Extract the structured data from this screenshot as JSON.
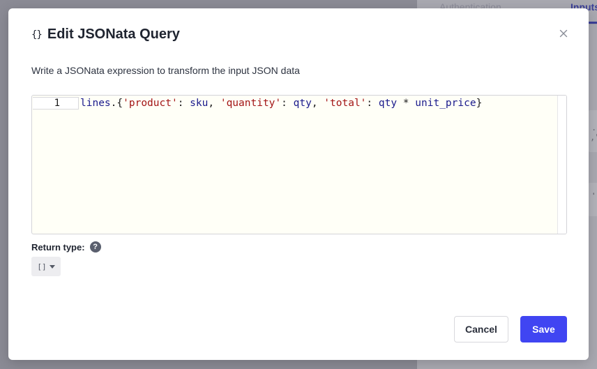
{
  "background": {
    "tabs": [
      {
        "label": "Authentication"
      },
      {
        "label": "Inputs"
      }
    ],
    "fragment_1": ".o",
    "fragment_2": ",\"",
    "fragment_3": "'"
  },
  "modal": {
    "header_icon": "{}",
    "title": "Edit JSONata Query",
    "description": "Write a JSONata expression to transform the input JSON data",
    "editor": {
      "line_number": "1",
      "tokens": [
        {
          "text": "lines",
          "kind": "id"
        },
        {
          "text": ".{",
          "kind": "punc"
        },
        {
          "text": "'product'",
          "kind": "str"
        },
        {
          "text": ": ",
          "kind": "punc"
        },
        {
          "text": "sku",
          "kind": "id"
        },
        {
          "text": ", ",
          "kind": "punc"
        },
        {
          "text": "'quantity'",
          "kind": "str"
        },
        {
          "text": ": ",
          "kind": "punc"
        },
        {
          "text": "qty",
          "kind": "id"
        },
        {
          "text": ", ",
          "kind": "punc"
        },
        {
          "text": "'total'",
          "kind": "str"
        },
        {
          "text": ": ",
          "kind": "punc"
        },
        {
          "text": "qty",
          "kind": "id"
        },
        {
          "text": " * ",
          "kind": "punc"
        },
        {
          "text": "unit_price",
          "kind": "id"
        },
        {
          "text": "}",
          "kind": "punc"
        }
      ]
    },
    "return_type": {
      "label": "Return type:",
      "help_icon": "?",
      "selected_value": "[]"
    },
    "buttons": {
      "cancel_label": "Cancel",
      "save_label": "Save"
    }
  },
  "colors": {
    "accent": "#4045f2",
    "editor_background": "#fffff7",
    "string_token": "#a31515",
    "identifier_token": "#1a1a8c"
  }
}
